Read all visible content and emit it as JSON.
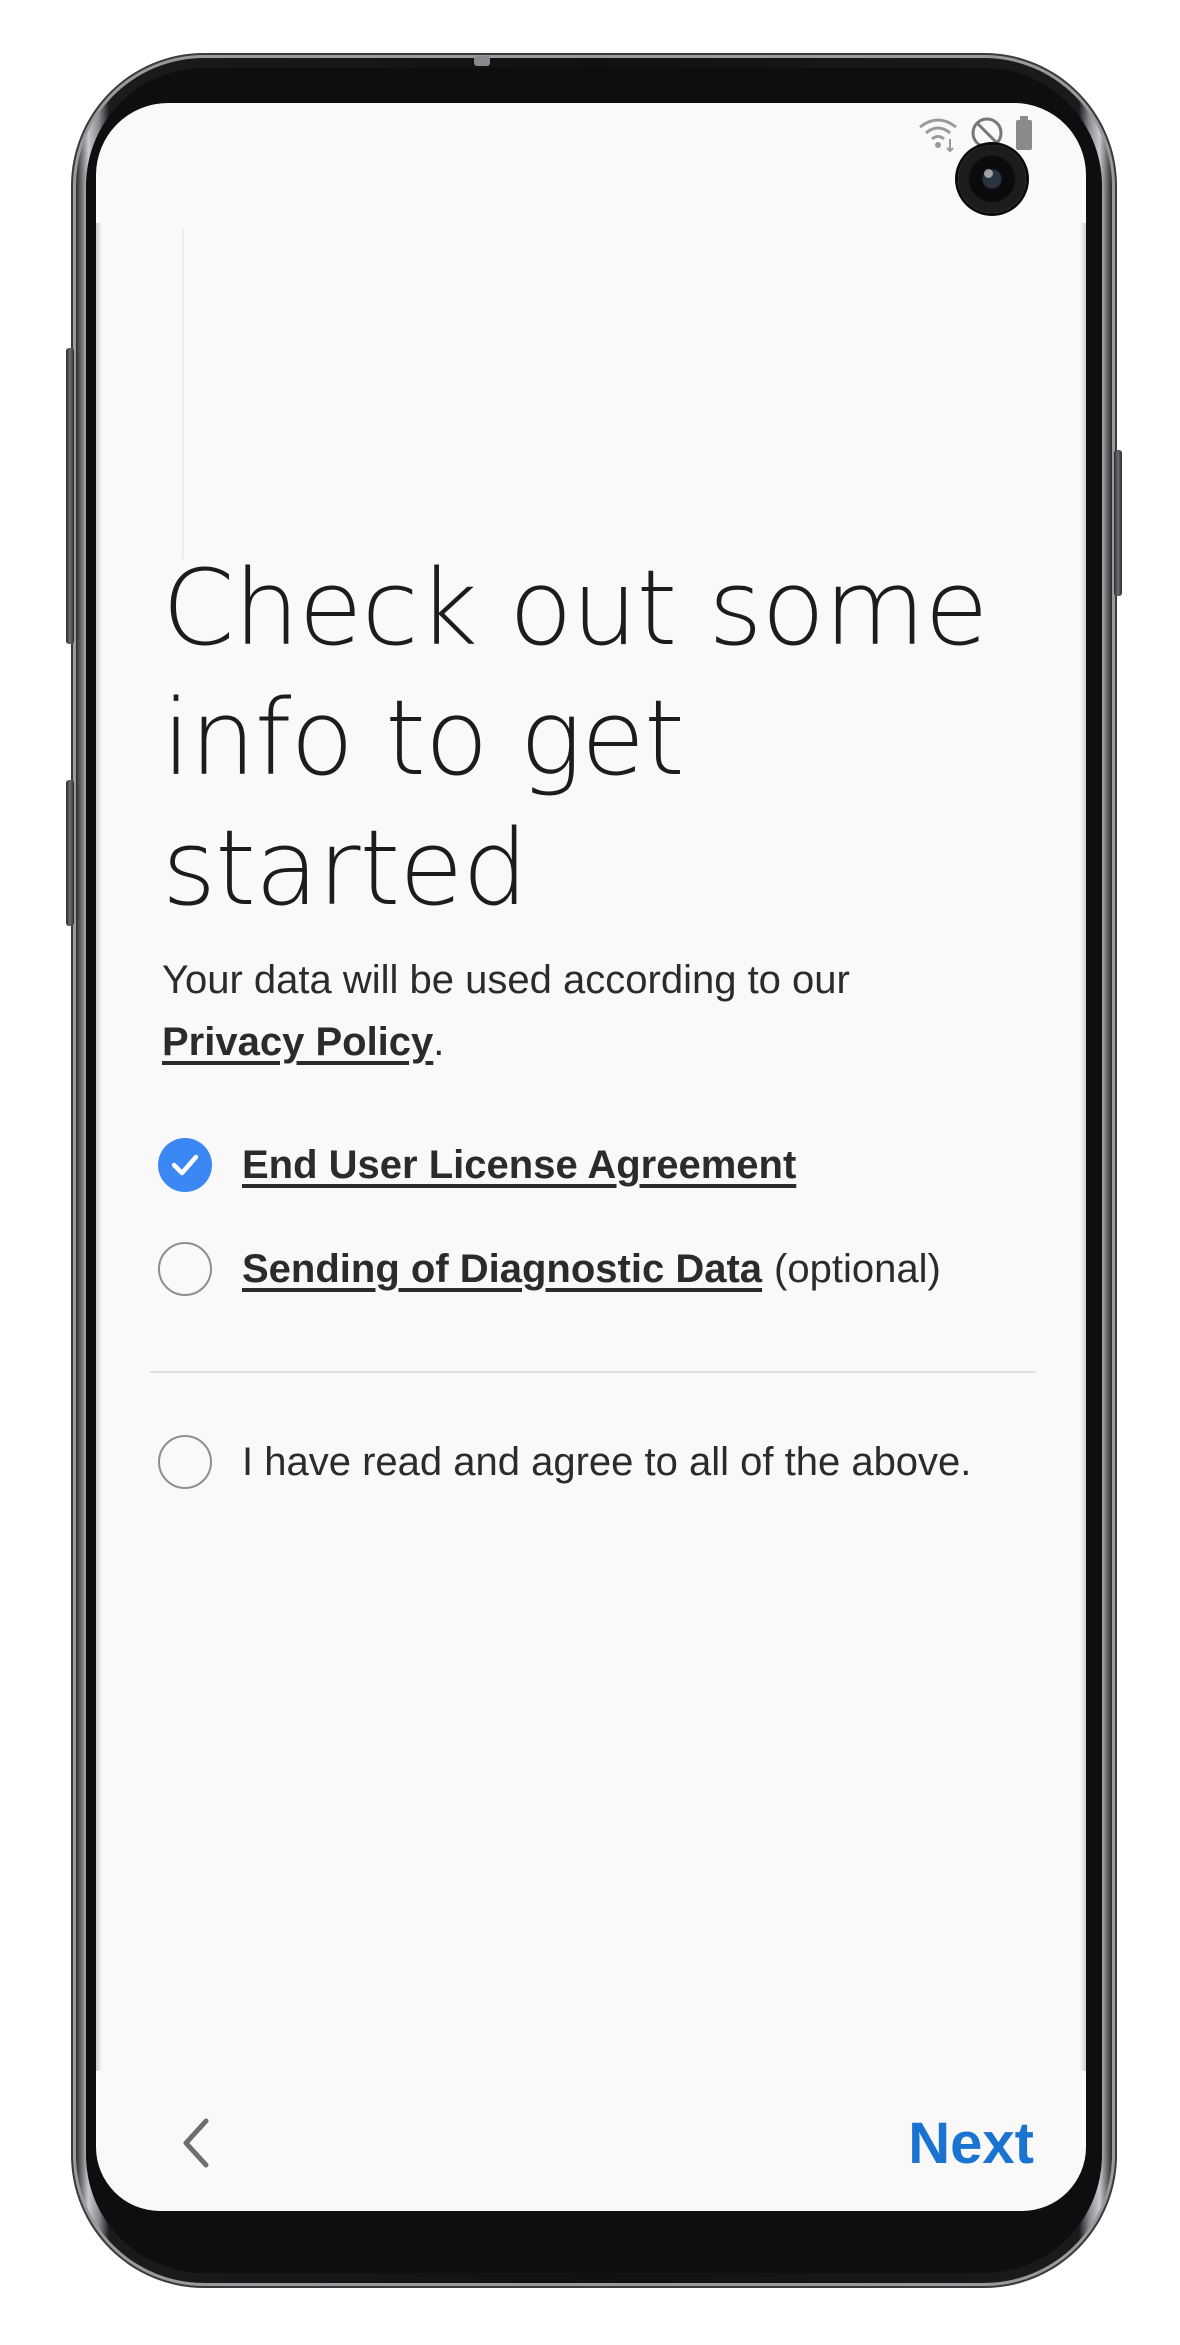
{
  "status_bar": {
    "icons": [
      "wifi-icon",
      "do-not-disturb-icon",
      "battery-icon"
    ]
  },
  "header": {
    "title_line1": "Check out some",
    "title_line2": "info to get started"
  },
  "intro": {
    "text": "Your data will be used according to our",
    "privacy_link": "Privacy Policy",
    "period": "."
  },
  "agreements": [
    {
      "label": "End User License Agreement",
      "suffix": "",
      "checked": true
    },
    {
      "label": "Sending of Diagnostic Data",
      "suffix": "(optional)",
      "checked": false
    }
  ],
  "agree_all": {
    "label": "I have read and agree to all of the above.",
    "checked": false
  },
  "footer": {
    "back_icon": "chevron-left-icon",
    "next_label": "Next"
  },
  "colors": {
    "accent": "#1a73d1",
    "checked": "#3b88f5",
    "screen_bg": "#f9f9f9"
  }
}
